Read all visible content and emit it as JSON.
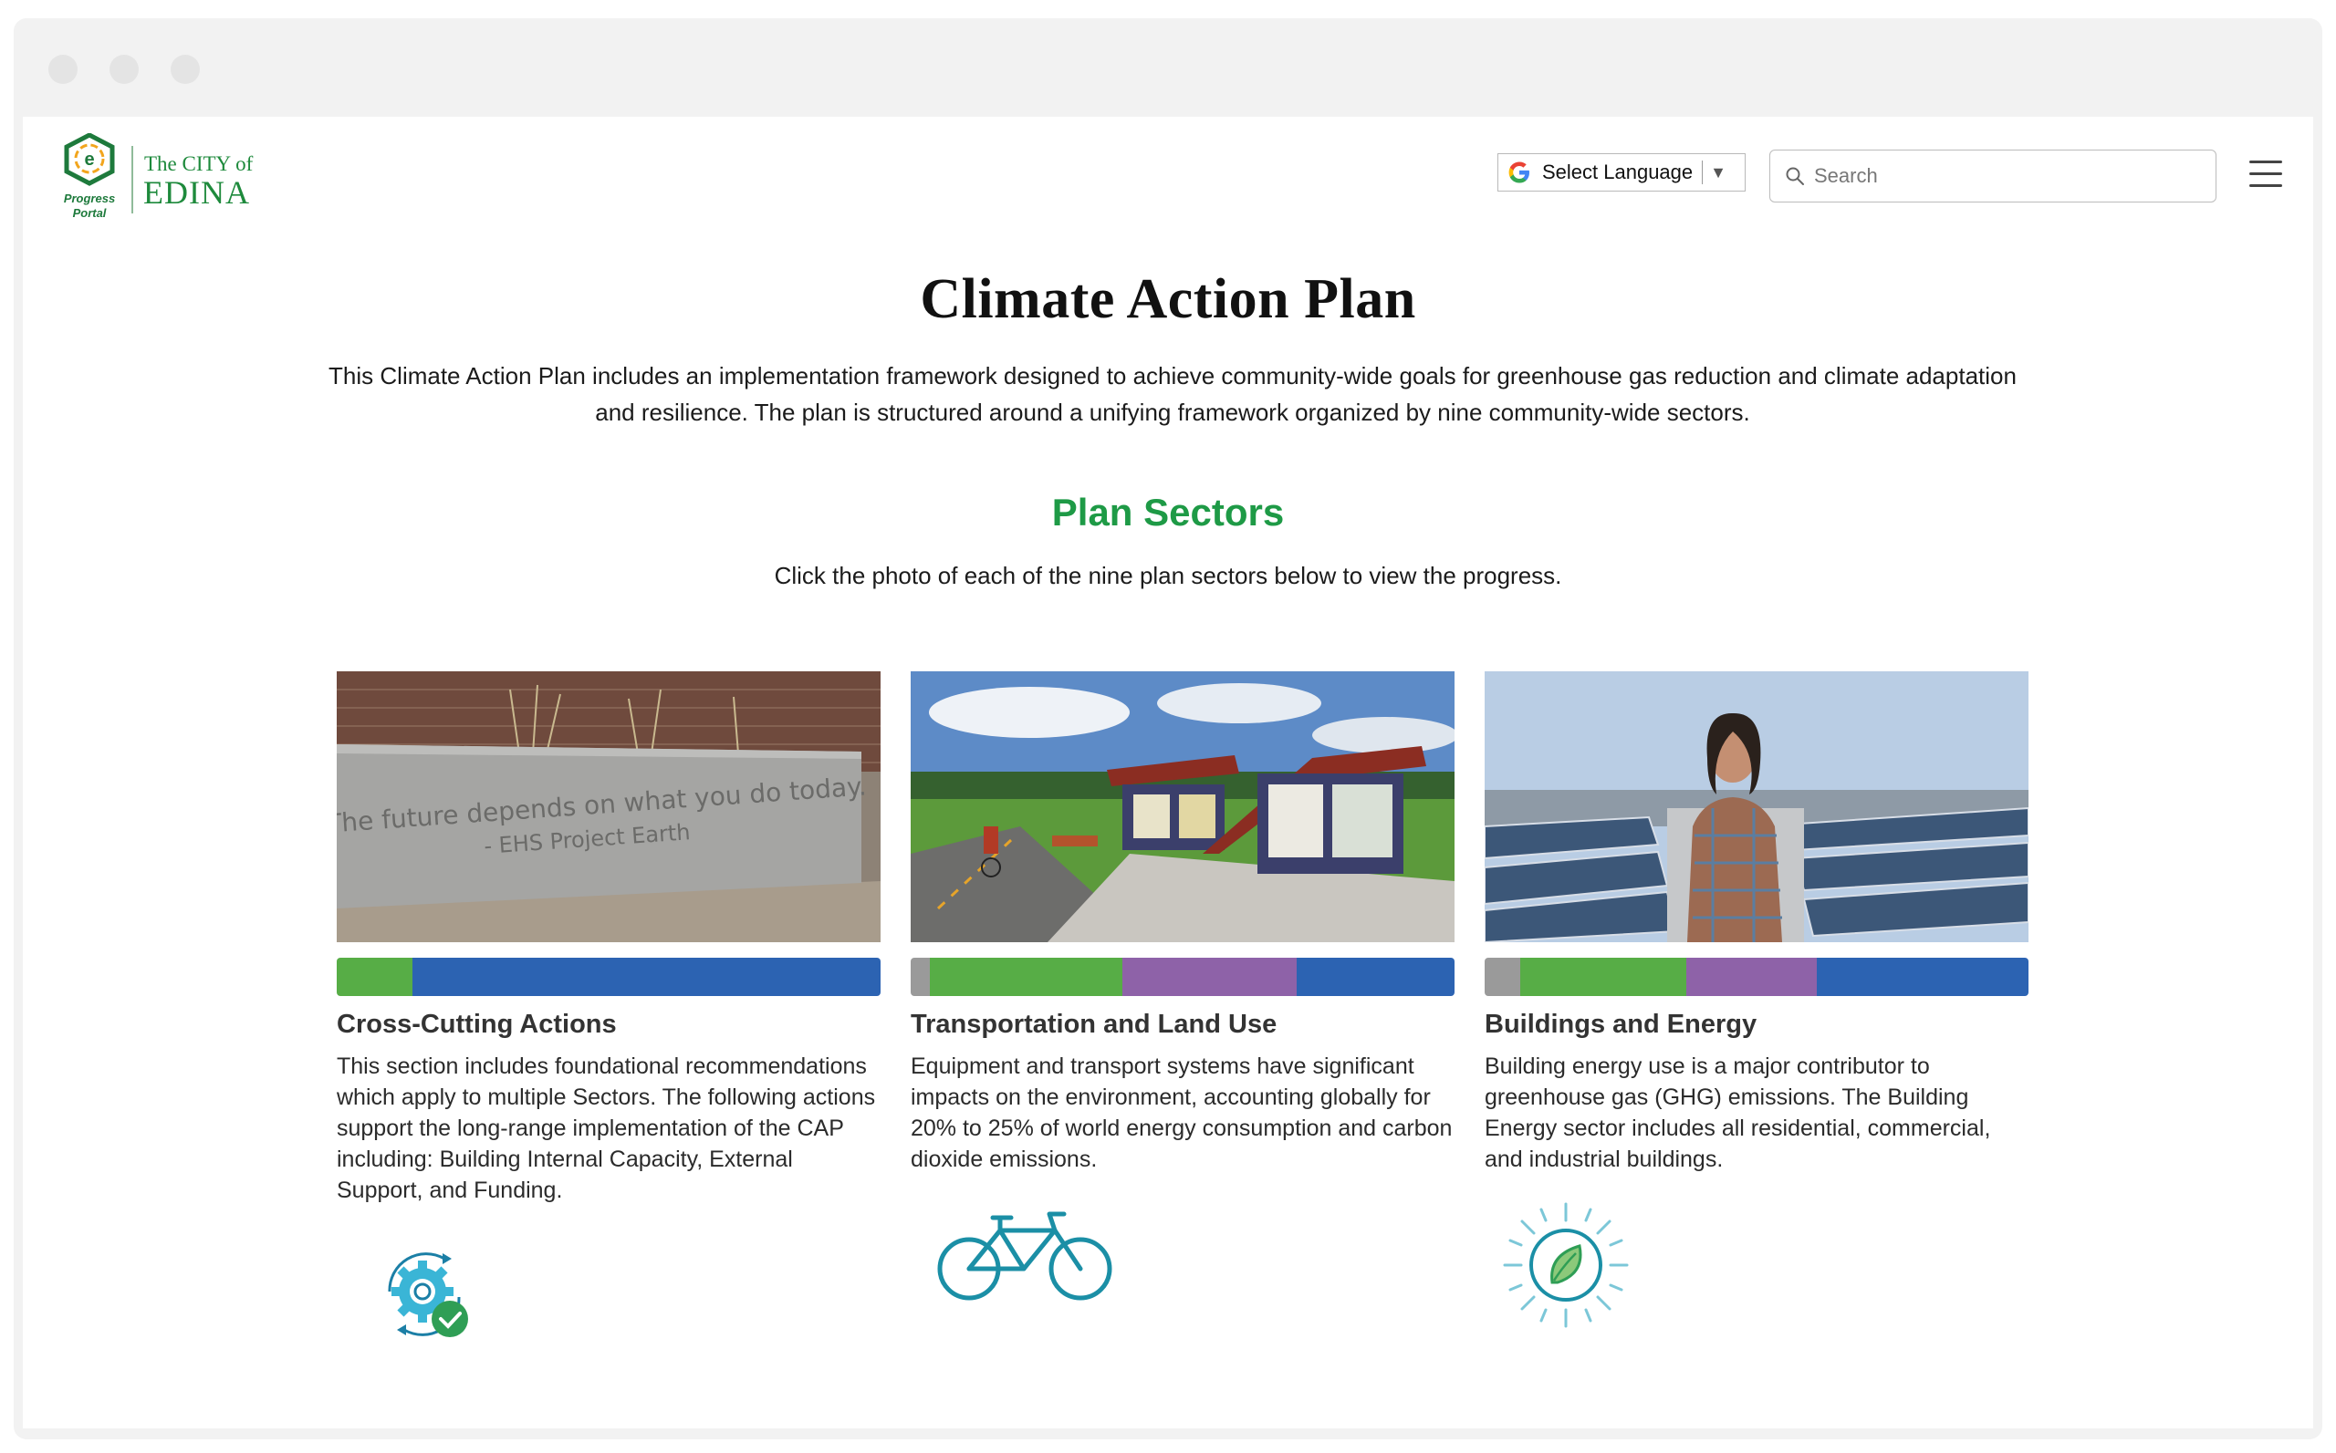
{
  "header": {
    "logo_badge_text": "Progress Portal",
    "logo_city_line1": "The CITY of",
    "logo_city_line2": "EDINA",
    "language_label": "Select Language",
    "search_placeholder": "Search",
    "menu_icon": "hamburger-icon"
  },
  "main": {
    "title": "Climate Action Plan",
    "intro": "This Climate Action Plan includes an implementation framework designed to achieve community-wide goals for greenhouse gas reduction and climate adaptation and resilience. The plan is structured around a unifying framework organized by nine community-wide sectors.",
    "section_title": "Plan Sectors",
    "section_subtitle": "Click the photo of each of the nine plan sectors  below to view the progress."
  },
  "colors": {
    "green": "#57ad46",
    "purple": "#8e62a8",
    "blue": "#2c63b2",
    "gray": "#9a9a9a",
    "heading_green": "#1e9a46"
  },
  "sectors": [
    {
      "name": "Cross-Cutting Actions",
      "description": "This section includes foundational recommendations which apply to multiple Sectors. The following actions support the long-range implementation of the CAP including: Building Internal Capacity, External Support, and Funding.",
      "photo_caption": "The future depends on what you do today. - EHS Project Earth",
      "icon": "gear-check-icon",
      "progress": [
        {
          "status": "green",
          "fraction": 0.14
        },
        {
          "status": "blue",
          "fraction": 0.86
        }
      ]
    },
    {
      "name": "Transportation and Land Use",
      "description": "Equipment and transport systems have significant impacts on the environment, accounting globally for 20% to 25% of world energy consumption and carbon dioxide emissions.",
      "icon": "bicycle-icon",
      "progress": [
        {
          "status": "gray",
          "fraction": 0.035
        },
        {
          "status": "green",
          "fraction": 0.355
        },
        {
          "status": "purple",
          "fraction": 0.32
        },
        {
          "status": "blue",
          "fraction": 0.29
        }
      ]
    },
    {
      "name": "Buildings and Energy",
      "description": "Building energy use is a major contributor to greenhouse gas (GHG) emissions. The Building Energy sector includes all residential, commercial, and industrial buildings.",
      "icon": "leaf-sun-icon",
      "progress": [
        {
          "status": "gray",
          "fraction": 0.065
        },
        {
          "status": "green",
          "fraction": 0.305
        },
        {
          "status": "purple",
          "fraction": 0.24
        },
        {
          "status": "blue",
          "fraction": 0.39
        }
      ]
    }
  ]
}
